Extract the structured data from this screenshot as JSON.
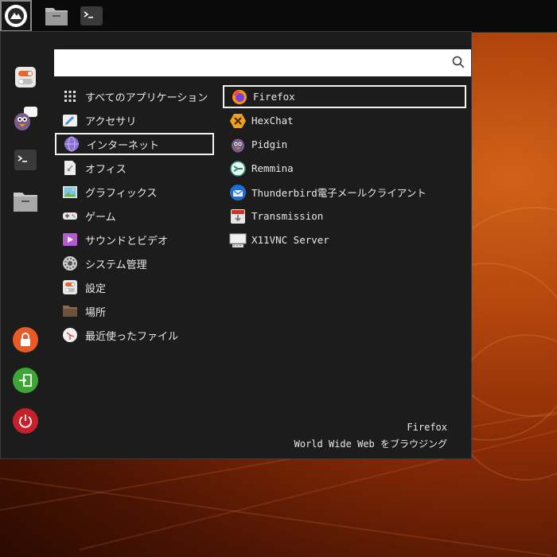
{
  "search": {
    "value": "",
    "placeholder": ""
  },
  "categories": [
    {
      "label": "すべてのアプリケーション",
      "icon": "grid-icon"
    },
    {
      "label": "アクセサリ",
      "icon": "accessories-icon"
    },
    {
      "label": "インターネット",
      "icon": "internet-icon"
    },
    {
      "label": "オフィス",
      "icon": "office-icon"
    },
    {
      "label": "グラフィックス",
      "icon": "graphics-icon"
    },
    {
      "label": "ゲーム",
      "icon": "gamepad-icon"
    },
    {
      "label": "サウンドとビデオ",
      "icon": "multimedia-icon"
    },
    {
      "label": "システム管理",
      "icon": "system-gear-icon"
    },
    {
      "label": "設定",
      "icon": "settings-icon"
    },
    {
      "label": "場所",
      "icon": "folder-icon"
    },
    {
      "label": "最近使ったファイル",
      "icon": "clock-icon"
    }
  ],
  "apps": [
    {
      "label": "Firefox",
      "icon": "firefox-icon"
    },
    {
      "label": "HexChat",
      "icon": "hexchat-icon"
    },
    {
      "label": "Pidgin",
      "icon": "pidgin-icon"
    },
    {
      "label": "Remmina",
      "icon": "remmina-icon"
    },
    {
      "label": "Thunderbird電子メールクライアント",
      "icon": "thunderbird-icon"
    },
    {
      "label": "Transmission",
      "icon": "transmission-icon"
    },
    {
      "label": "X11VNC Server",
      "icon": "vnc-icon"
    }
  ],
  "description": {
    "name": "Firefox",
    "text": "World Wide Web をブラウジング"
  },
  "colors": {
    "panel": "#0a0a0a",
    "menu_bg": "#1c1c1c",
    "selection_border": "#f2f2f2",
    "desktop_accent": "#c8561a"
  }
}
